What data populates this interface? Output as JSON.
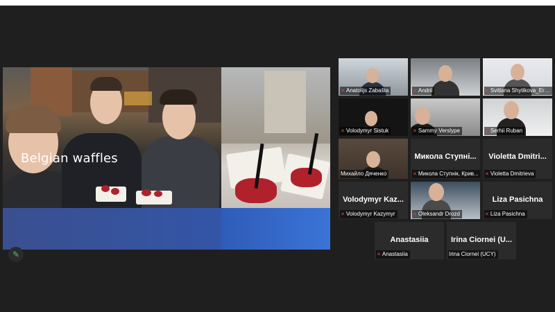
{
  "presentation": {
    "caption": "Belgian waffles"
  },
  "participants": [
    {
      "name": "Anatolijs Zabašta",
      "muted": true
    },
    {
      "name": "Andrii",
      "muted": true
    },
    {
      "name": "Svitlana Shytikova_Era...",
      "muted": true
    },
    {
      "name": "Volodymyr Sistuk",
      "muted": true
    },
    {
      "name": "Sammy Verslype",
      "muted": true
    },
    {
      "name": "Serhii Ruban",
      "muted": true
    },
    {
      "name": "Михайло Дяченко",
      "muted": false,
      "active": true
    },
    {
      "display": "Микола Ступні...",
      "name": "Микола Ступнік, Крив...",
      "muted": true
    },
    {
      "display": "Violetta Dmitri...",
      "name": "Violetta Dmitrieva",
      "muted": true
    },
    {
      "display": "Volodymyr Kaz...",
      "name": "Volodymyr Kazymyr",
      "muted": true
    },
    {
      "name": "Oleksandr Drozd",
      "muted": true
    },
    {
      "display": "Liza Pasichna",
      "name": "Liza Pasichna",
      "muted": true
    },
    {
      "display": "Anastasiia",
      "name": "Anastasiia",
      "muted": true
    },
    {
      "display": "Irina Ciornei (U...",
      "name": "Irina Ciornei (UCY)",
      "muted": false
    }
  ],
  "icons": {
    "annotate": "pen-icon",
    "mic_off": "mic-off-icon"
  },
  "colors": {
    "background": "#1f1f1f",
    "active_border": "#d9c68a",
    "muted": "#e04848"
  }
}
